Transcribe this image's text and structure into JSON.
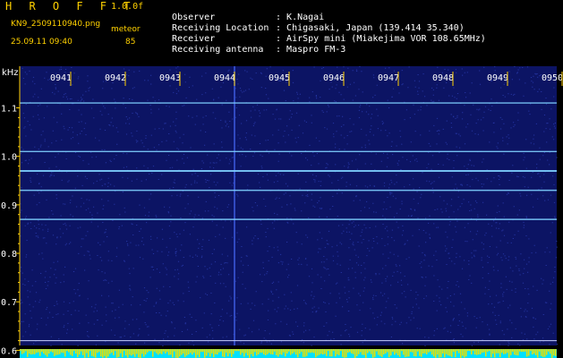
{
  "header": {
    "app_title": "H R O F F T",
    "version": "1.0.0f",
    "file_name": "KN9_2509110940.png",
    "mode_label": "meteor",
    "datetime": "25.09.11 09:40",
    "count": "85"
  },
  "metadata": [
    {
      "label": "Observer",
      "sep": ":",
      "value": "K.Nagai"
    },
    {
      "label": "Receiving Location",
      "sep": ":",
      "value": "Chigasaki, Japan (139.414 35.340)"
    },
    {
      "label": "Receiver",
      "sep": ":",
      "value": "AirSpy mini (Miakejima VOR 108.65MHz)"
    },
    {
      "label": "Receiving antenna",
      "sep": ":",
      "value": "Maspro FM-3"
    }
  ],
  "chart_data": {
    "type": "heatmap",
    "ylabel": "kHz",
    "x_ticks": [
      "0941",
      "0942",
      "0943",
      "0944",
      "0945",
      "0946",
      "0947",
      "0948",
      "0949",
      "0950"
    ],
    "y_ticks": [
      "1.1",
      "1.0",
      "0.9",
      "0.8",
      "0.7",
      "0.6"
    ],
    "ylim": [
      0.61,
      1.16
    ],
    "horizontal_lines_khz": [
      1.11,
      1.01,
      0.97,
      0.93,
      0.87
    ],
    "reference_line_khz": 0.62,
    "vertical_line_minute": "0944",
    "colors": {
      "background": "#0c1464",
      "signal": "#7fd0ff",
      "axis": "#ffd100",
      "bottom_bar": "#00e0ff",
      "tick": "#ffd100"
    }
  }
}
